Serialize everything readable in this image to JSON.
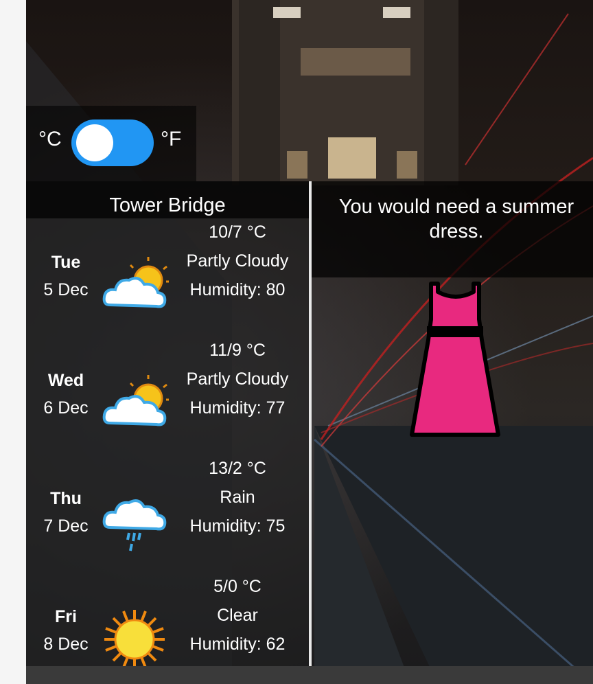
{
  "unit_toggle": {
    "celsius_label": "°C",
    "fahrenheit_label": "°F",
    "selected": "°C"
  },
  "city": {
    "name": "Tower Bridge"
  },
  "advice": {
    "text": "You would need a summer dress.",
    "clothing_icon": "dress-icon",
    "clothing_color": "#e8297f"
  },
  "forecast": [
    {
      "day": "Tue",
      "date": "5 Dec",
      "temp": "10/7 °C",
      "condition": "Partly Cloudy",
      "humidity": "Humidity: 80",
      "icon": "partly-cloudy-icon"
    },
    {
      "day": "Wed",
      "date": "6 Dec",
      "temp": "11/9 °C",
      "condition": "Partly Cloudy",
      "humidity": "Humidity: 77",
      "icon": "partly-cloudy-icon"
    },
    {
      "day": "Thu",
      "date": "7 Dec",
      "temp": "13/2 °C",
      "condition": "Rain",
      "humidity": "Humidity: 75",
      "icon": "rain-icon"
    },
    {
      "day": "Fri",
      "date": "8 Dec",
      "temp": "5/0 °C",
      "condition": "Clear",
      "humidity": "Humidity: 62",
      "icon": "sun-icon"
    }
  ],
  "colors": {
    "toggle_accent": "#2196f3"
  }
}
